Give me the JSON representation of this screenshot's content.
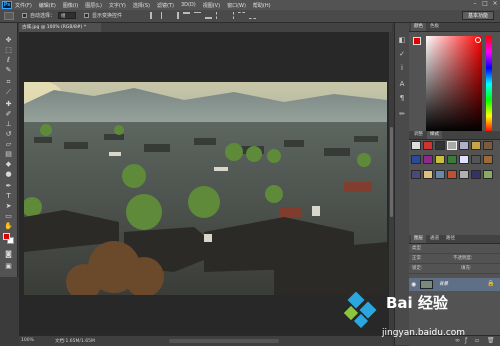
{
  "menu": {
    "logo": "Ps",
    "items": [
      "文件(F)",
      "编辑(E)",
      "图像(I)",
      "图层(L)",
      "文字(Y)",
      "选择(S)",
      "滤镜(T)",
      "3D(D)",
      "视图(V)",
      "窗口(W)",
      "帮助(H)"
    ]
  },
  "options": {
    "auto_select_label": "自动选择：",
    "auto_select_value": "组",
    "show_transform_label": "显示变换控件",
    "workspace": "基本功能"
  },
  "document": {
    "tab_label": "古城.jpg @ 100% (RGB/8#) *"
  },
  "status": {
    "zoom": "100%",
    "doc_size": "文档:1.65M/1.65M"
  },
  "panels": {
    "color_tabs": [
      "颜色",
      "色板"
    ],
    "style_tabs": [
      "调整",
      "样式"
    ],
    "layer_tabs": [
      "图层",
      "通道",
      "路径"
    ],
    "layer_kind": "类型",
    "blend_mode": "正常",
    "opacity_label": "不透明度:",
    "lock_label": "锁定:",
    "fill_label": "填充:",
    "layer_name": "背景"
  },
  "colors": {
    "foreground": "#e10000",
    "background": "#ffffff",
    "accent": "#31a8ff"
  },
  "icons": [
    "move-icon",
    "marquee-icon",
    "lasso-icon",
    "quick-select-icon",
    "crop-icon",
    "eyedropper-icon",
    "healing-icon",
    "brush-icon",
    "stamp-icon",
    "history-brush-icon",
    "eraser-icon",
    "gradient-icon",
    "blur-icon",
    "dodge-icon",
    "pen-icon",
    "type-icon",
    "path-select-icon",
    "shape-icon",
    "hand-icon",
    "zoom-icon"
  ],
  "watermark": {
    "text": "Bai 经验",
    "url": "jingyan.baidu.com"
  }
}
